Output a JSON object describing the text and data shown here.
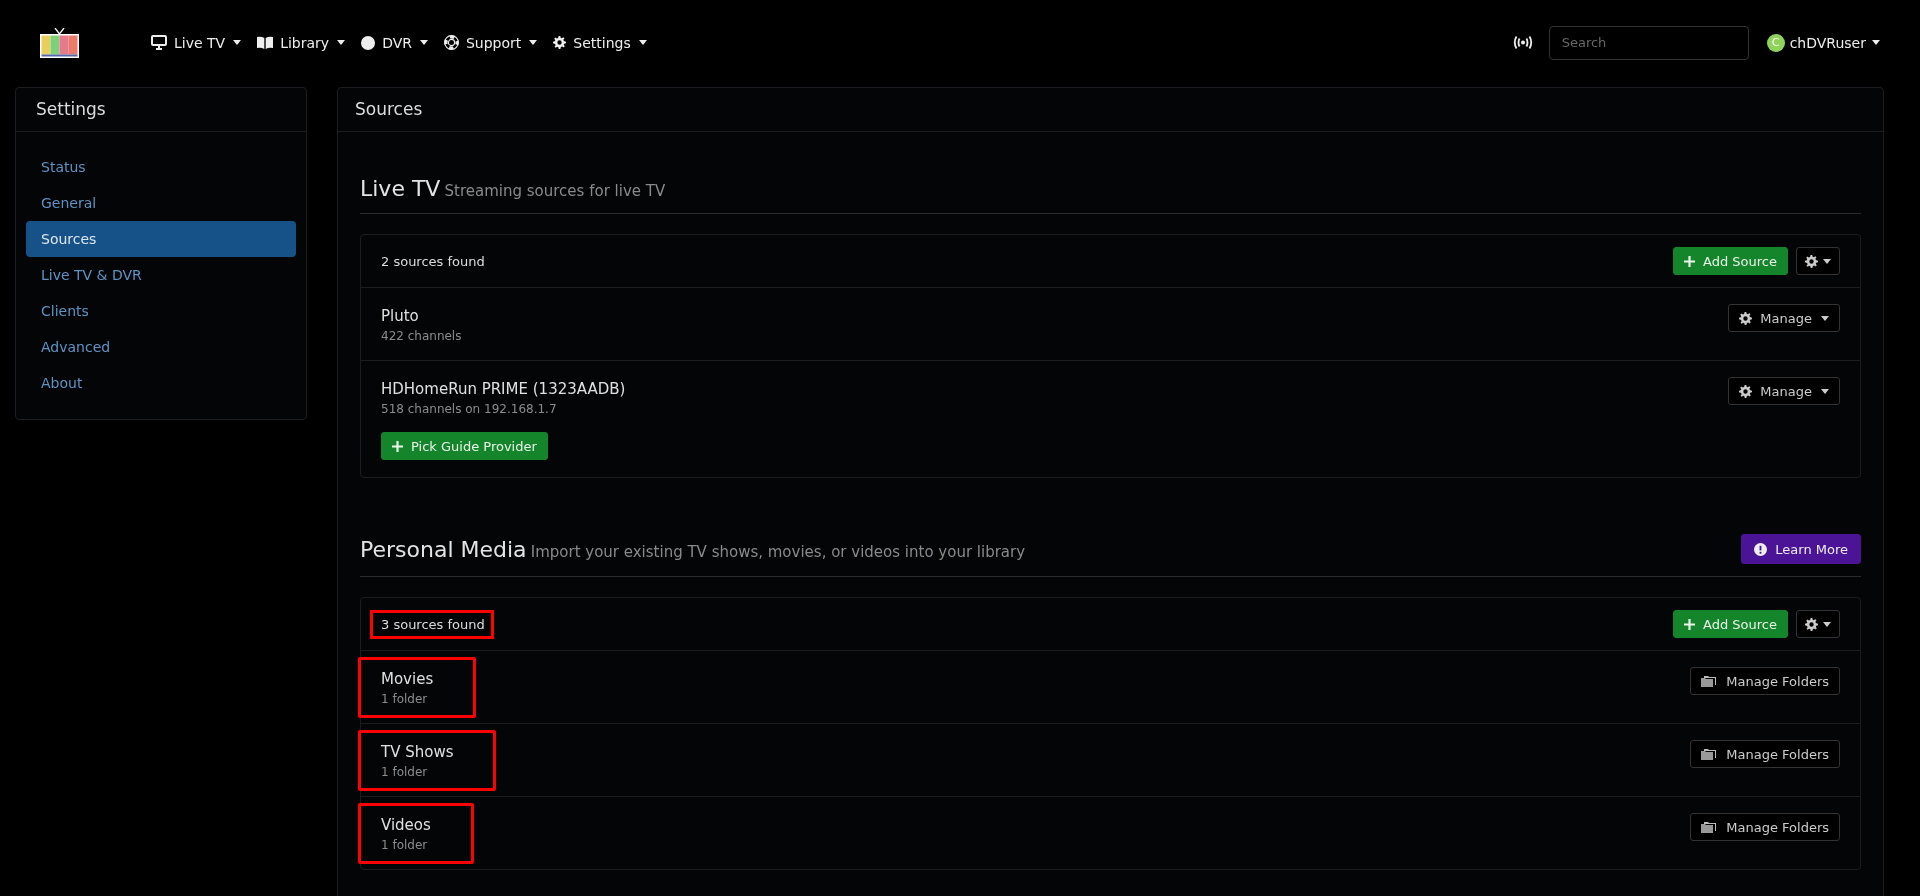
{
  "navbar": {
    "menus": [
      {
        "label": "Live TV"
      },
      {
        "label": "Library"
      },
      {
        "label": "DVR"
      },
      {
        "label": "Support"
      },
      {
        "label": "Settings"
      }
    ],
    "search": {
      "placeholder": "Search"
    },
    "user": {
      "avatar": "C",
      "name": "chDVRuser"
    }
  },
  "sidebar": {
    "title": "Settings",
    "items": [
      {
        "label": "Status",
        "selected": false
      },
      {
        "label": "General",
        "selected": false
      },
      {
        "label": "Sources",
        "selected": true
      },
      {
        "label": "Live TV & DVR",
        "selected": false
      },
      {
        "label": "Clients",
        "selected": false
      },
      {
        "label": "Advanced",
        "selected": false
      },
      {
        "label": "About",
        "selected": false
      }
    ]
  },
  "main": {
    "title": "Sources",
    "sections": [
      {
        "title": "Live TV",
        "subtitle": "Streaming sources for live TV",
        "count": "2 sources found",
        "count_highlighted": false,
        "add_button": "Add Source",
        "sources": [
          {
            "name": "Pluto",
            "detail": "422 channels",
            "highlighted": false,
            "action": {
              "kind": "manage",
              "label": "Manage"
            }
          },
          {
            "name": "HDHomeRun PRIME (1323AADB)",
            "detail": "518 channels on 192.168.1.7",
            "highlighted": false,
            "action": {
              "kind": "manage",
              "label": "Manage"
            },
            "extra_button": "Pick Guide Provider"
          }
        ]
      },
      {
        "title": "Personal Media",
        "subtitle": "Import your existing TV shows, movies, or videos into your library",
        "learn_more": "Learn More",
        "count": "3 sources found",
        "count_highlighted": true,
        "add_button": "Add Source",
        "sources": [
          {
            "name": "Movies",
            "detail": "1 folder",
            "highlighted": true,
            "action": {
              "kind": "folders",
              "label": "Manage Folders"
            }
          },
          {
            "name": "TV Shows",
            "detail": "1 folder",
            "highlighted": true,
            "action": {
              "kind": "folders",
              "label": "Manage Folders"
            }
          },
          {
            "name": "Videos",
            "detail": "1 folder",
            "highlighted": true,
            "action": {
              "kind": "folders",
              "label": "Manage Folders"
            }
          }
        ]
      }
    ]
  }
}
